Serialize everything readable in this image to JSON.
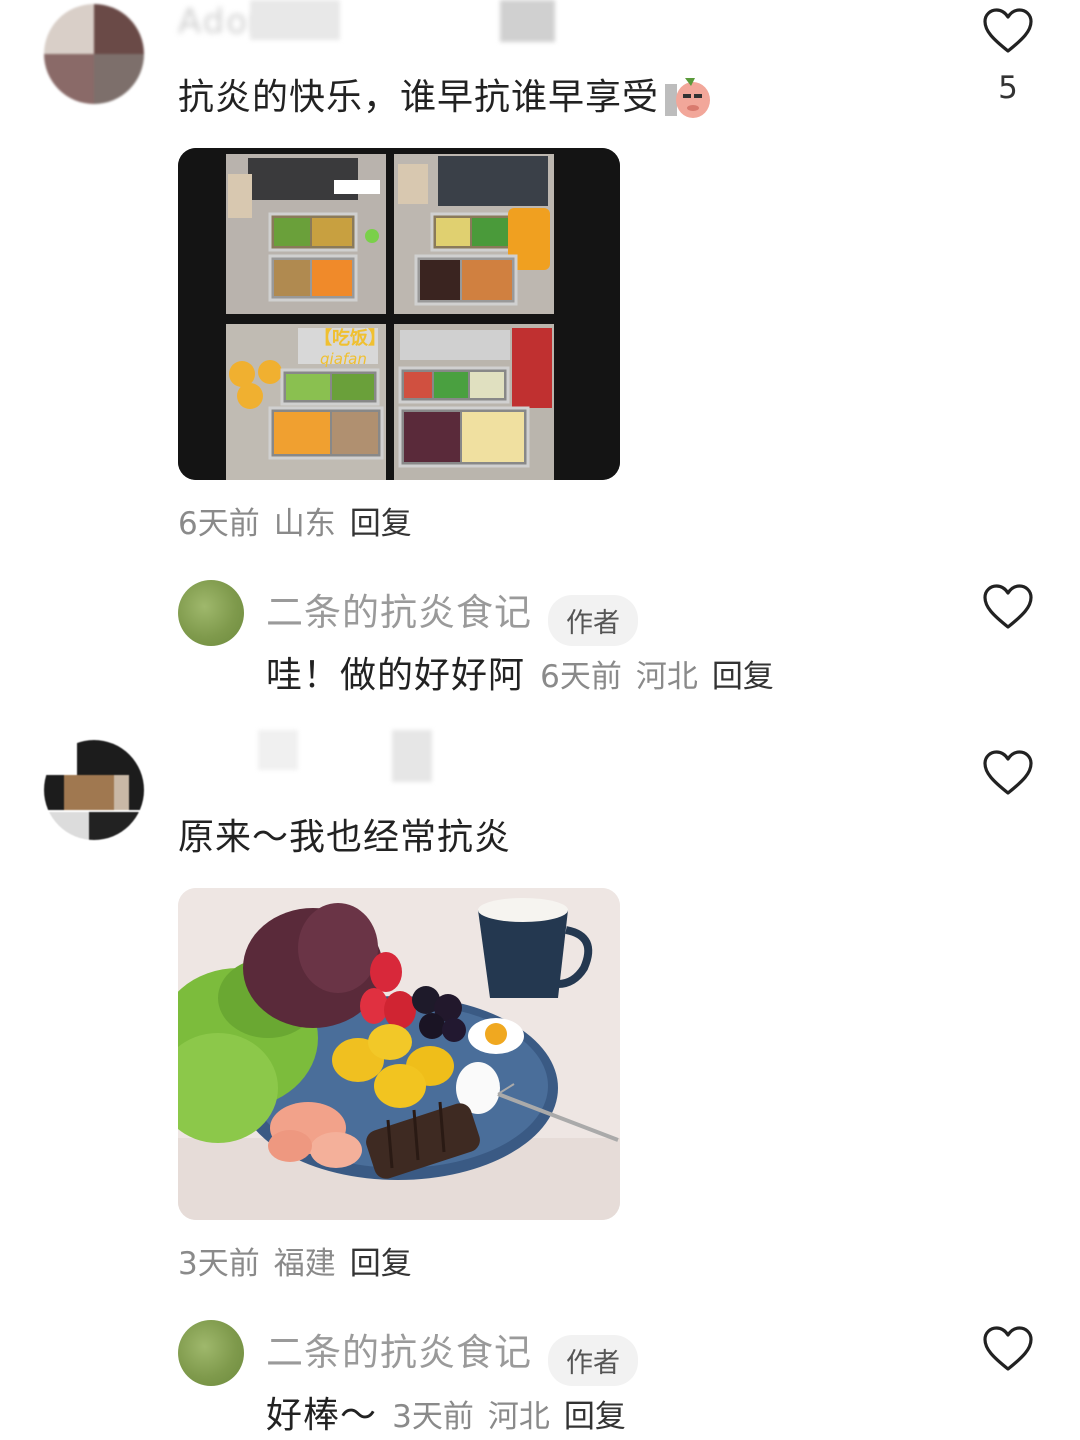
{
  "comments": [
    {
      "username": "Adorbon",
      "text": "抗炎的快乐，谁早抗谁早享受",
      "likes": "5",
      "time": "6天前",
      "location": "山东",
      "reply_label": "回复",
      "reply": {
        "author": "二条的抗炎食记",
        "badge": "作者",
        "text": "哇！做的好好阿",
        "time": "6天前",
        "location": "河北",
        "reply_label": "回复"
      }
    },
    {
      "text": "原来～我也经常抗炎",
      "time": "3天前",
      "location": "福建",
      "reply_label": "回复",
      "reply": {
        "author": "二条的抗炎食记",
        "badge": "作者",
        "text": "好棒～",
        "time": "3天前",
        "location": "河北",
        "reply_label": "回复"
      }
    }
  ],
  "collage_labels": {
    "tag": "【吃饭】",
    "sub": "qiafan"
  },
  "icons": {
    "like": "heart-outline-icon",
    "sticker": "pig-sticker-icon"
  },
  "colors": {
    "text": "#222222",
    "meta": "#8a8a8a",
    "badge_bg": "#f2f2f2"
  }
}
